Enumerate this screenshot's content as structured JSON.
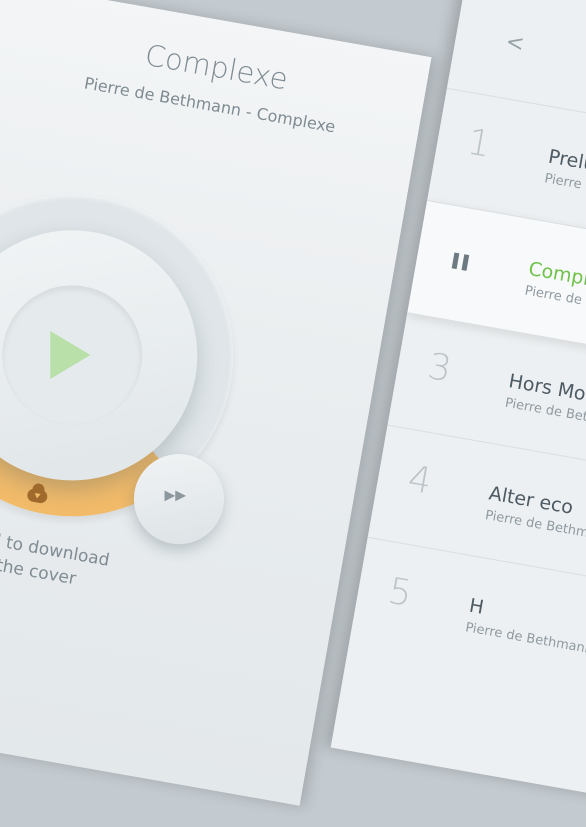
{
  "player": {
    "album_title": "Complexe",
    "album_subtitle": "Pierre de Bethmann - Complexe",
    "pull_text_line1": "Pull to download",
    "pull_text_line2": "the cover",
    "rewind_glyph": "◀◀",
    "forward_glyph": "▶▶"
  },
  "tracklist": {
    "back_glyph": "<",
    "tracks": [
      {
        "num": "1",
        "title": "Prelude",
        "artist": "Pierre de Bethmann - Complexe"
      },
      {
        "num": "",
        "title": "Complexe",
        "artist": "Pierre de Bethmann - Complexe",
        "playing": true
      },
      {
        "num": "3",
        "title": "Hors Modes",
        "artist": "Pierre de Bethmann - Complexe"
      },
      {
        "num": "4",
        "title": "Alter eco",
        "artist": "Pierre de Bethmann - Complexe"
      },
      {
        "num": "5",
        "title": "H",
        "artist": "Pierre de Bethmann - Complexe"
      }
    ]
  },
  "colors": {
    "accent_green": "#6fc24a",
    "download_orange": "#f2bb6a"
  },
  "icons": [
    "play-icon",
    "rewind-icon",
    "fast-forward-icon",
    "cloud-download-icon",
    "pause-icon",
    "back-arrow-icon"
  ]
}
